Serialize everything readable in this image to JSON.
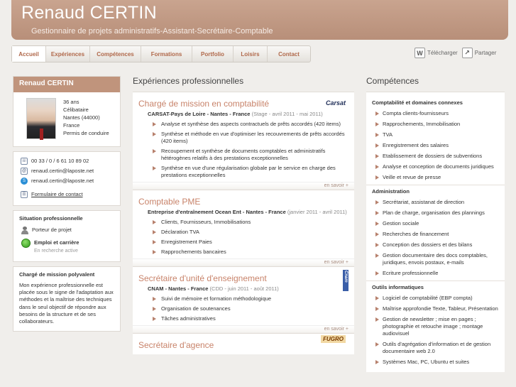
{
  "header": {
    "name": "Renaud CERTIN",
    "subtitle": "Gestionnaire de projets administratifs-Assistant-Secrétaire-Comptable"
  },
  "nav": [
    "Accueil",
    "Expériences",
    "Compétences",
    "Formations",
    "Portfolio",
    "Loisirs",
    "Contact"
  ],
  "nav_active": "Accueil",
  "actions": {
    "download": "Télécharger",
    "share": "Partager"
  },
  "profile": {
    "title": "Renaud CERTIN",
    "lines": [
      "36 ans",
      "Célibataire",
      "Nantes (44000)",
      "France",
      "Permis de conduire"
    ]
  },
  "contact": {
    "phone": "00 33 / 0 / 6 61 10 89 02",
    "email": "renaud.certin@laposte.net",
    "skype": "renaud.certin@laposte.net",
    "form_link": "Formulaire de contact"
  },
  "situation": {
    "title": "Situation professionnelle",
    "role": "Porteur de projet",
    "status_title": "Emploi et carrière",
    "status_sub": "En recherche active"
  },
  "summary": {
    "title": "Chargé de mission polyvalent",
    "text": "Mon expérience professionnelle est placée sous le signe de l'adaptation aux méthodes et la maîtrise des techniques dans le seul objectif de répondre aux besoins de la structure et de ses collaborateurs."
  },
  "experiences_title": "Expériences professionnelles",
  "more_label": "en savoir +",
  "experiences": [
    {
      "title": "Chargé de mission en comptabilité",
      "logo": "Carsat",
      "org": "CARSAT-Pays de Loire - Nantes - France",
      "period": "(Stage - avril 2011 - mai 2011)",
      "items": [
        "Analyse et synthèse des aspects contractuels de prêts accordés (420 items)",
        "Synthèse et méthode en vue d'optimiser les recouvrements de prêts accordés (420 items)",
        "Recoupement et synthèse de documents comptables et administratifs hétérogènes relatifs à des prestations exceptionnelles",
        "Synthèse en vue d'une régularisation globale par le service en charge des prestations exceptionnelles"
      ]
    },
    {
      "title": "Comptable PME",
      "logo": "",
      "org": "Entreprise d'entraînement Ocean Ent - Nantes - France",
      "period": "(janvier 2011 - avril 2011)",
      "items": [
        "Clients, Fournisseurs, Immobilisations",
        "Déclaration TVA",
        "Enregistrement Paies",
        "Rapprochements bancaires"
      ]
    },
    {
      "title": "Secrétaire d'unité d'enseignement",
      "logo": "Cnam",
      "org": "CNAM - Nantes - France",
      "period": "(CDD - juin 2011 - août 2011)",
      "items": [
        "Suivi de mémoire et formation méthodologique",
        "Organisation de soutenances",
        "Tâches administratives"
      ]
    },
    {
      "title": "Secrétaire d'agence",
      "logo": "FUGRO",
      "org": "",
      "period": "",
      "items": []
    }
  ],
  "competences_title": "Compétences",
  "competences": [
    {
      "heading": "Comptabilité et domaines connexes",
      "items": [
        "Compta clients-fournisseurs",
        "Rapprochements, Immobilisation",
        "TVA",
        "Enregistrement des salaires",
        "Etablissement de dossiers de subventions",
        "Analyse et conception de documents juridiques",
        "Veille et revue de presse"
      ]
    },
    {
      "heading": "Administration",
      "items": [
        "Secrétariat, assistanat de direction",
        "Plan de charge, organisation des plannings",
        "Gestion sociale",
        "Recherches de financement",
        "Conception des dossiers et des bilans",
        "Gestion documentaire des docs comptables, juridiques, envois postaux, e-mails",
        "Ecriture professionnelle"
      ]
    },
    {
      "heading": "Outils informatiques",
      "items": [
        "Logiciel de comptabilité (EBP compta)",
        "Maîtrise approfondie Texte, Tableur, Présentation",
        "Gestion de newsletter ; mise en pages ; photographie et retouche image ; montage audiovisuel",
        "Outils d'agrégation d'information et de gestion documentaire web 2.0",
        "Systèmes Mac, PC, Ubuntu et suites"
      ]
    }
  ]
}
